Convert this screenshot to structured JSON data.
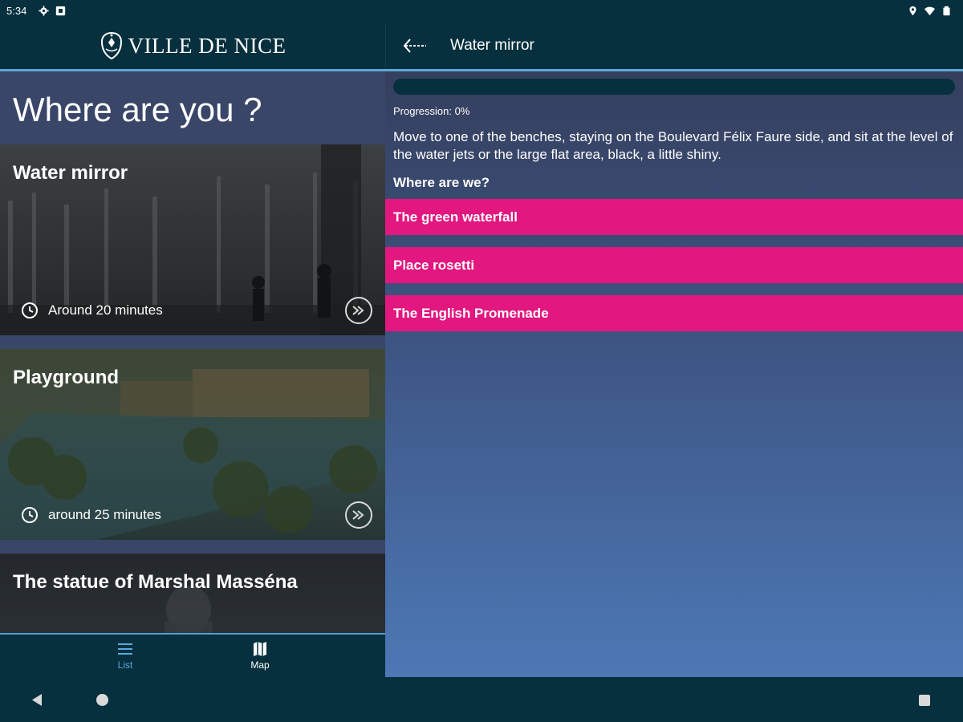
{
  "status_bar": {
    "time": "5:34",
    "left_icons": [
      "gear-icon",
      "notification-icon"
    ],
    "right_icons": [
      "location-icon",
      "wifi-icon",
      "battery-icon"
    ]
  },
  "left_panel": {
    "logo_text": "VILLE DE NICE",
    "list_title": "Where are you ?",
    "cards": [
      {
        "title": "Water mirror",
        "duration": "Around 20 minutes"
      },
      {
        "title": "Playground",
        "duration": "around 25 minutes"
      },
      {
        "title": "The statue of Marshal Masséna"
      }
    ],
    "bottom_nav": [
      {
        "label": "List",
        "icon": "list-icon",
        "active": true
      },
      {
        "label": "Map",
        "icon": "map-icon",
        "active": false
      }
    ]
  },
  "right_panel": {
    "title": "Water mirror",
    "progress_value": 0,
    "progress_label": "Progression: 0%",
    "instruction": "Move to one of the benches, staying on the Boulevard Félix Faure side, and sit at the level of the water jets or the large flat area, black, a little shiny.",
    "question": "Where are we?",
    "answers": [
      "The green waterfall",
      "Place rosetti",
      "The English Promenade"
    ]
  },
  "colors": {
    "background": "#06303d",
    "accent": "#5aa9d6",
    "answer_button": "#e2177f",
    "list_background": "#394668"
  }
}
